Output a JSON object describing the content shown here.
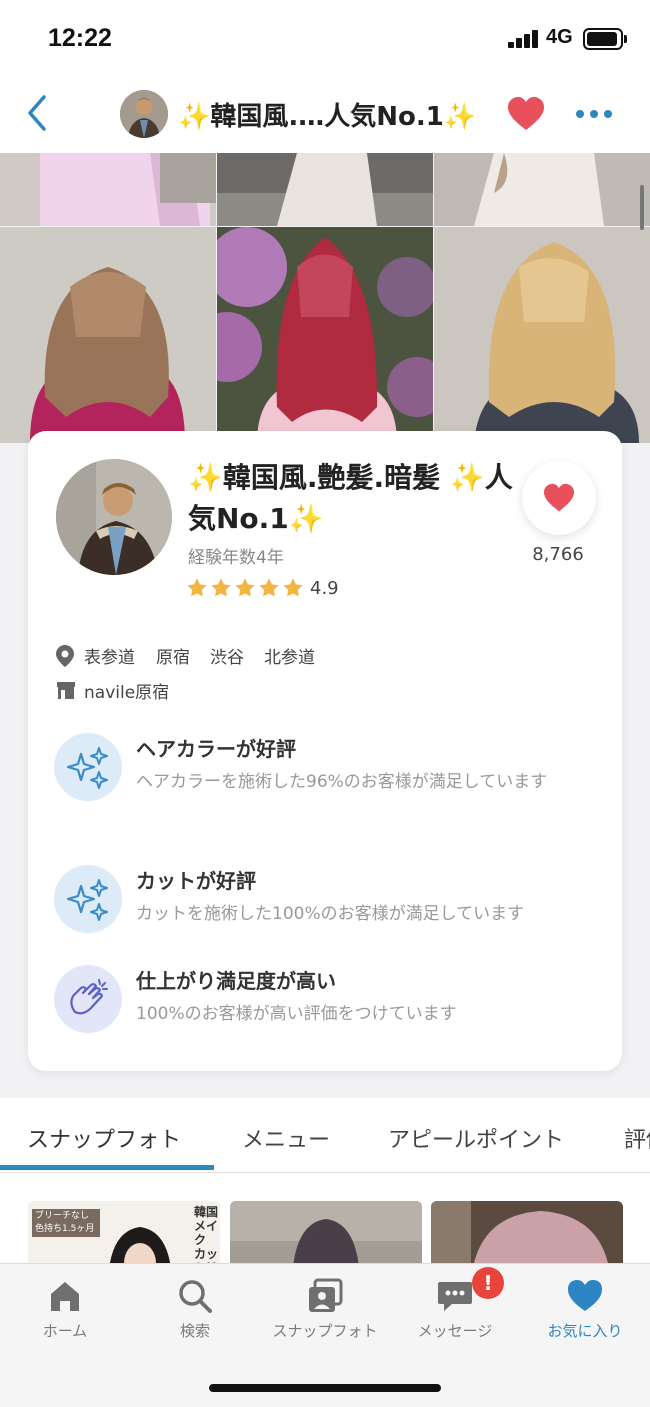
{
  "status_bar": {
    "time": "12:22",
    "network": "4G"
  },
  "header": {
    "title": "✨韓国風.…人気No.1✨"
  },
  "profile": {
    "name": "✨韓国風.艶髪.暗髪 ✨人気No.1✨",
    "experience": "経験年数4年",
    "rating": "4.9",
    "stars": 5,
    "favorites_count": "8,766",
    "areas": [
      "表参道",
      "原宿",
      "渋谷",
      "北参道"
    ],
    "salon": "navile原宿"
  },
  "features": [
    {
      "title": "ヘアカラーが好評",
      "desc": "ヘアカラーを施術した96%のお客様が満足しています",
      "icon": "sparkle-icon"
    },
    {
      "title": "カットが好評",
      "desc": "カットを施術した100%のお客様が満足しています",
      "icon": "sparkle-icon"
    },
    {
      "title": "仕上がり満足度が高い",
      "desc": "100%のお客様が高い評価をつけています",
      "icon": "clapping-hands-icon"
    }
  ],
  "tabs": [
    "スナップフォト",
    "メニュー",
    "アピールポイント",
    "評価"
  ],
  "active_tab": "スナップフォト",
  "snap_preview_text": {
    "tag": "ブリーチなし 色持ち1.5ヶ月",
    "side": "韓国メイク カットは難"
  },
  "bottom_nav": [
    {
      "label": "ホーム",
      "icon": "home-icon"
    },
    {
      "label": "検索",
      "icon": "search-icon"
    },
    {
      "label": "スナップフォト",
      "icon": "photos-icon"
    },
    {
      "label": "メッセージ",
      "icon": "message-icon"
    },
    {
      "label": "お気に入り",
      "icon": "heart-icon"
    }
  ],
  "active_nav": "お気に入り",
  "message_badge": "!",
  "colors": {
    "accent": "#2d86c4",
    "heart": "#e8505b",
    "star": "#f2b53f",
    "badge": "#e8443b"
  }
}
